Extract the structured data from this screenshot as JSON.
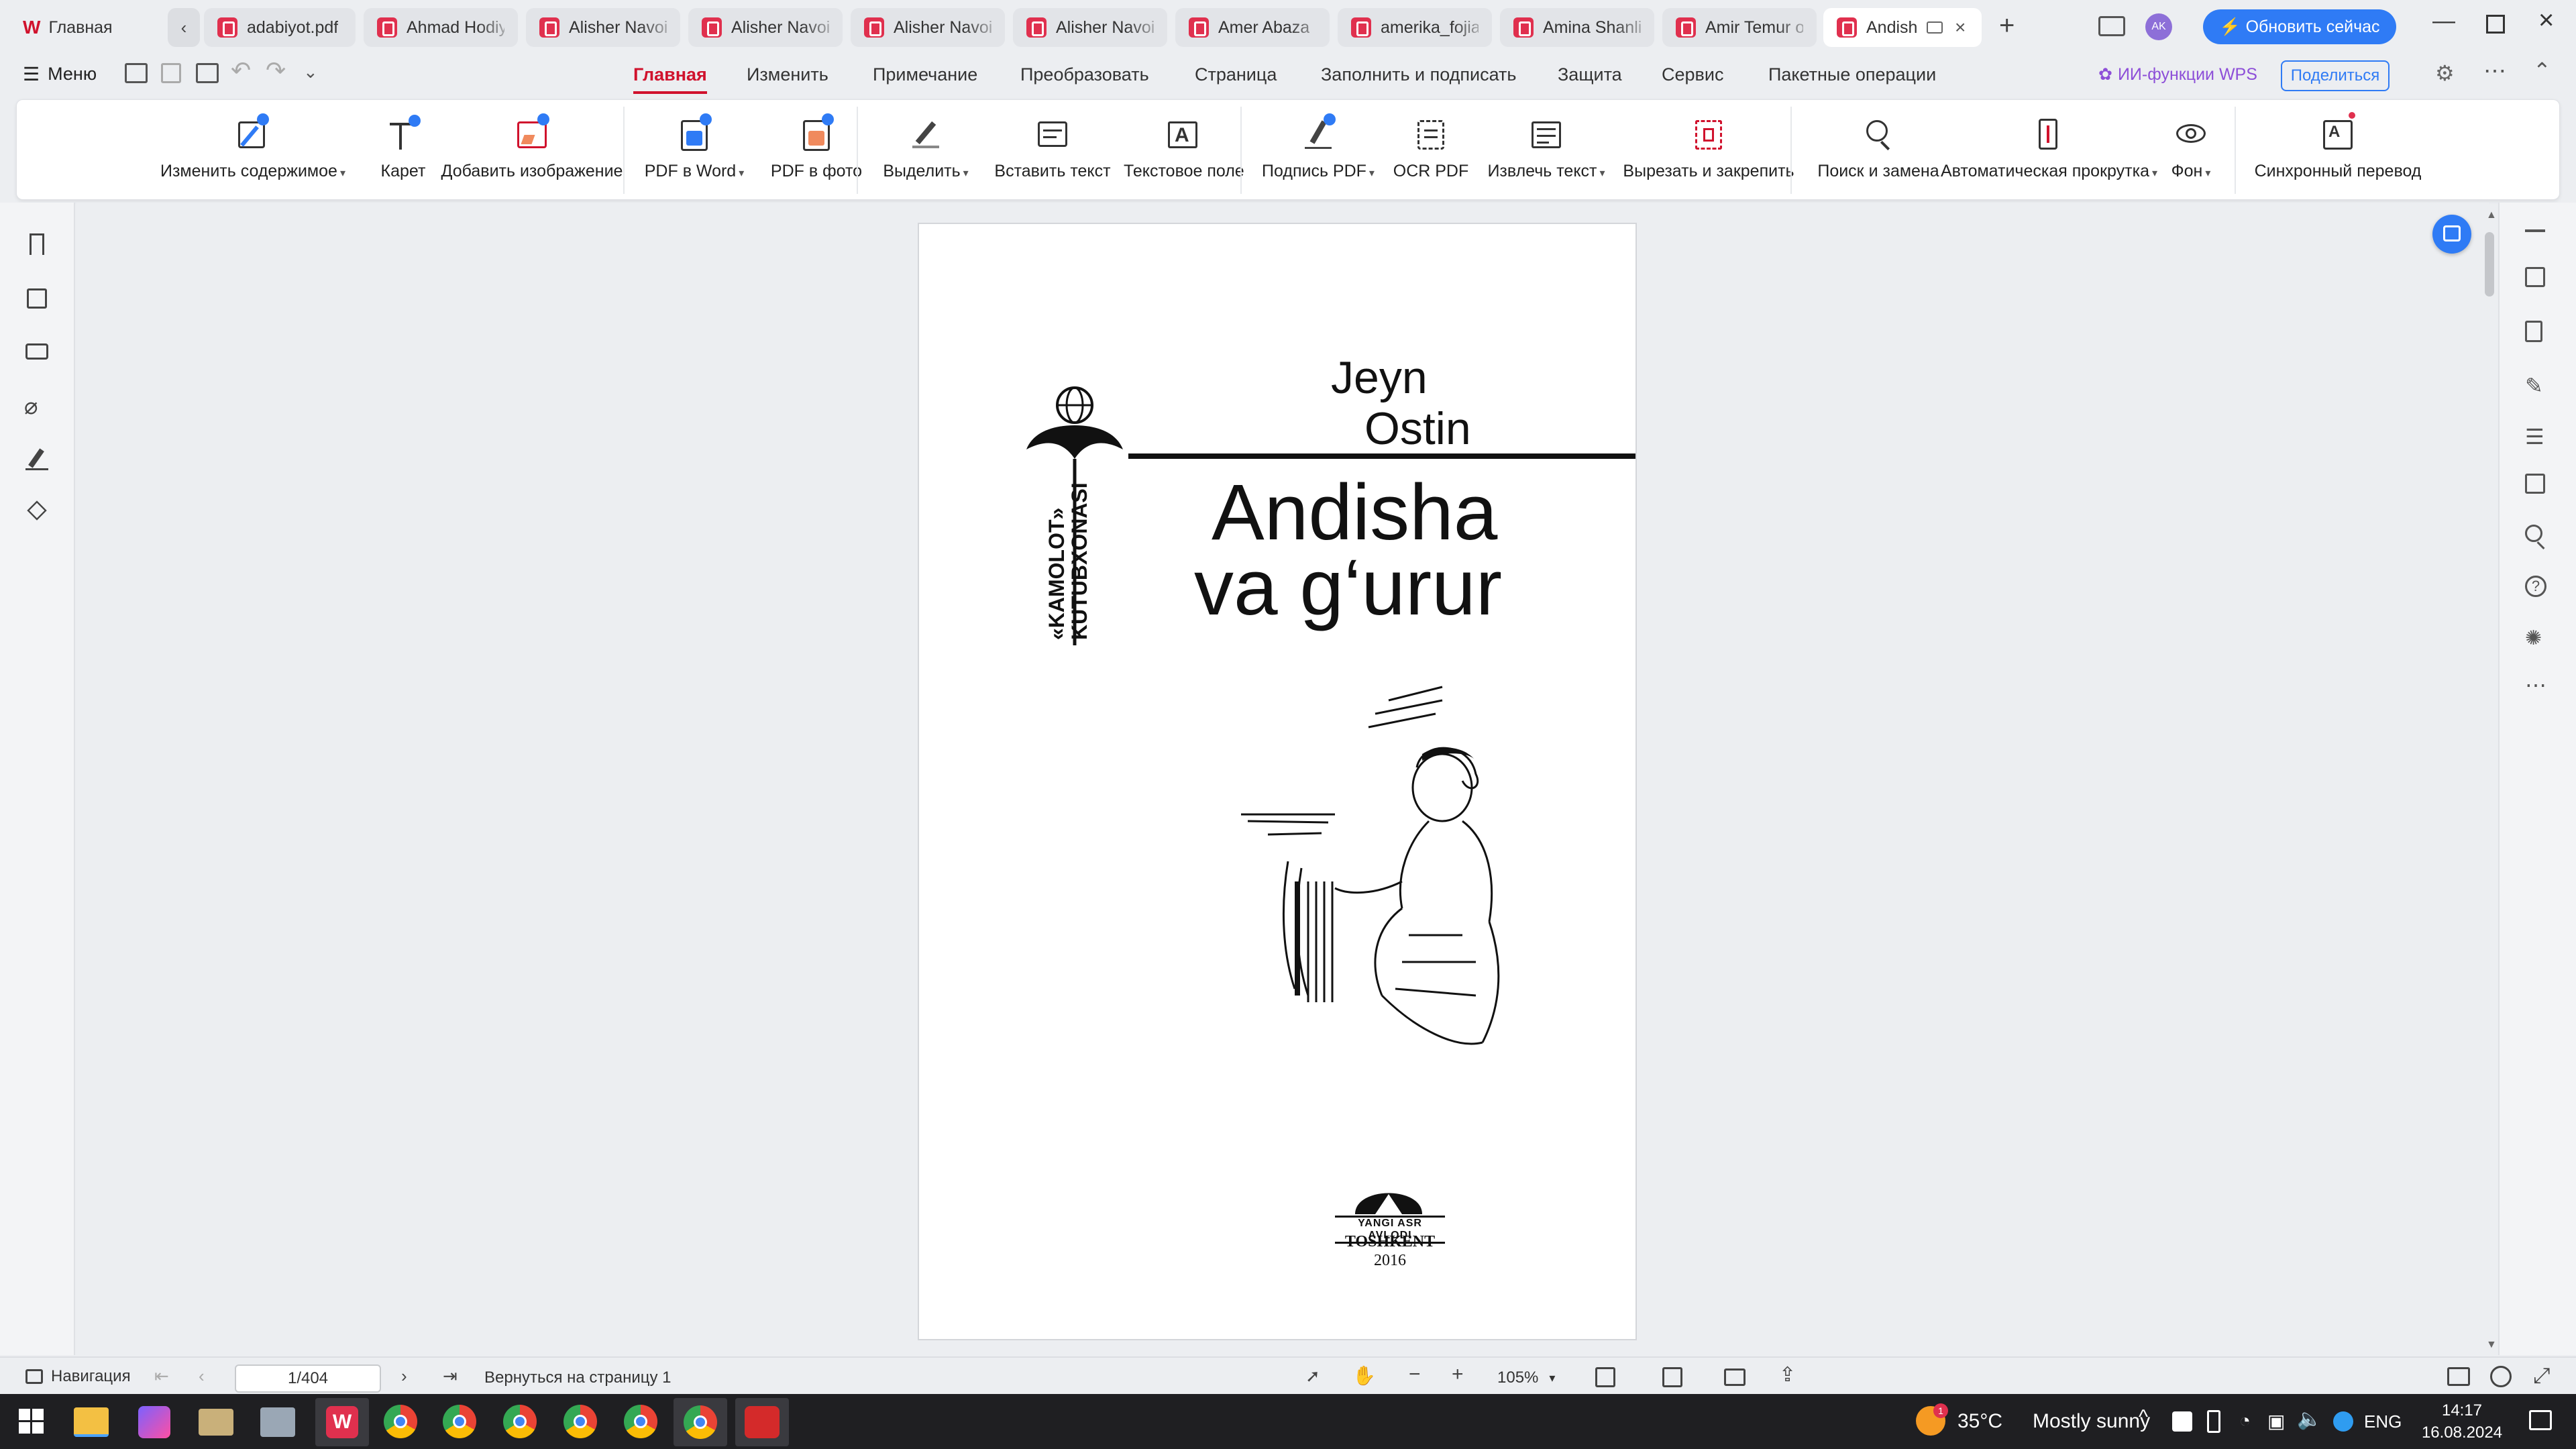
{
  "tabs": {
    "home": "Главная",
    "files": [
      "adabiyot.pdf",
      "Ahmad Hodiy",
      "Alisher Navoiy",
      "Alisher Navoiy",
      "Alisher Navoiy",
      "Alisher Navoiy",
      "Amer Abaza",
      "amerika_fojias",
      "Amina Shanlik",
      "Amir Temur o'",
      "Andish"
    ],
    "new_tab": "+",
    "update_button": "Обновить сейчас",
    "avatar_initials": "AK"
  },
  "menu": {
    "menu_label": "Меню",
    "tabs": [
      "Главная",
      "Изменить",
      "Примечание",
      "Преобразовать",
      "Страница",
      "Заполнить и подписать",
      "Защита",
      "Сервис",
      "Пакетные операции"
    ],
    "active_tab": "Главная",
    "ai_label": "ИИ-функции WPS",
    "share_label": "Поделиться"
  },
  "ribbon": {
    "buttons": [
      {
        "label": "Изменить содержимое",
        "icon": "edit-content-icon",
        "dropdown": true
      },
      {
        "label": "Карет",
        "icon": "text-caret-icon",
        "dropdown": false
      },
      {
        "label": "Добавить изображение",
        "icon": "add-image-icon",
        "dropdown": false
      },
      {
        "label": "PDF в Word",
        "icon": "pdf-to-word-icon",
        "dropdown": true
      },
      {
        "label": "PDF в фото",
        "icon": "pdf-to-image-icon",
        "dropdown": false
      },
      {
        "label": "Выделить",
        "icon": "highlight-icon",
        "dropdown": true
      },
      {
        "label": "Вставить текст",
        "icon": "insert-text-icon",
        "dropdown": false
      },
      {
        "label": "Текстовое поле",
        "icon": "text-box-icon",
        "dropdown": false
      },
      {
        "label": "Подпись PDF",
        "icon": "signature-icon",
        "dropdown": true
      },
      {
        "label": "OCR PDF",
        "icon": "ocr-icon",
        "dropdown": false
      },
      {
        "label": "Извлечь текст",
        "icon": "extract-text-icon",
        "dropdown": true
      },
      {
        "label": "Вырезать и закрепить",
        "icon": "crop-pin-icon",
        "dropdown": false
      },
      {
        "label": "Поиск и замена",
        "icon": "search-replace-icon",
        "dropdown": false
      },
      {
        "label": "Автоматическая прокрутка",
        "icon": "auto-scroll-icon",
        "dropdown": true
      },
      {
        "label": "Фон",
        "icon": "background-icon",
        "dropdown": true
      },
      {
        "label": "Синхронный перевод",
        "icon": "translate-icon",
        "dropdown": false
      }
    ]
  },
  "document": {
    "author_line1": "Jeyn",
    "author_line2": "Ostin",
    "title_line1": "Andisha",
    "title_line2": "va g‘urur",
    "series_line1": "«KAMOLOT»",
    "series_line2": "KUTUBXONASI",
    "publisher": "YANGI ASR AVLODI",
    "city": "TOSHKENT",
    "year": "2016"
  },
  "status": {
    "nav_label": "Навигация",
    "page_indicator": "1/404",
    "back_to_page": "Вернуться на страницу 1",
    "zoom": "105%"
  },
  "taskbar": {
    "temperature": "35°C",
    "weather": "Mostly sunny",
    "language": "ENG",
    "time": "14:17",
    "date": "16.08.2024",
    "weather_badge": "1"
  },
  "colors": {
    "accent_red": "#d0122d",
    "update_blue": "#2f7bf5",
    "pdf_red": "#e0304e"
  }
}
